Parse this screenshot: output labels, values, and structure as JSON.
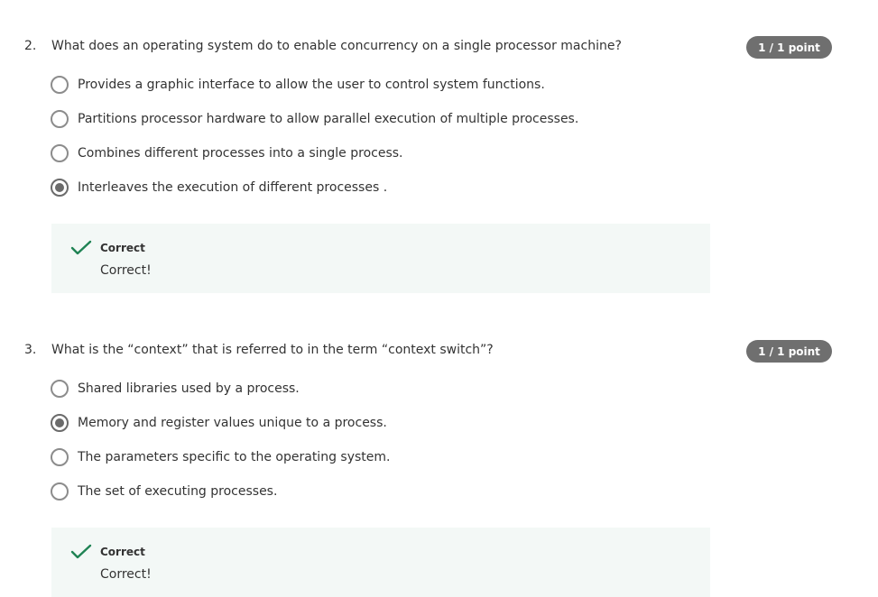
{
  "questions": [
    {
      "number": "2.",
      "text": "What does an operating system do to enable concurrency on a single processor machine?",
      "points": "1 / 1 point",
      "options": [
        {
          "label": "Provides a graphic interface to allow the user to control system functions.",
          "selected": false
        },
        {
          "label": "Partitions processor hardware to allow parallel execution of multiple processes.",
          "selected": false
        },
        {
          "label": "Combines different processes into a single process.",
          "selected": false
        },
        {
          "label": "Interleaves the execution of different processes .",
          "selected": true
        }
      ],
      "feedback": {
        "title": "Correct",
        "text": "Correct!"
      }
    },
    {
      "number": "3.",
      "text": "What is the “context” that is referred to in the term “context switch”?",
      "points": "1 / 1 point",
      "options": [
        {
          "label": "Shared libraries used by a process.",
          "selected": false
        },
        {
          "label": "Memory and register values unique to a process.",
          "selected": true
        },
        {
          "label": "The parameters specific to the operating system.",
          "selected": false
        },
        {
          "label": "The set of executing processes.",
          "selected": false
        }
      ],
      "feedback": {
        "title": "Correct",
        "text": "Correct!"
      }
    }
  ],
  "colors": {
    "badge": "#6f6f6f",
    "feedback_bg": "#f3f8f6",
    "check": "#1f8354"
  }
}
